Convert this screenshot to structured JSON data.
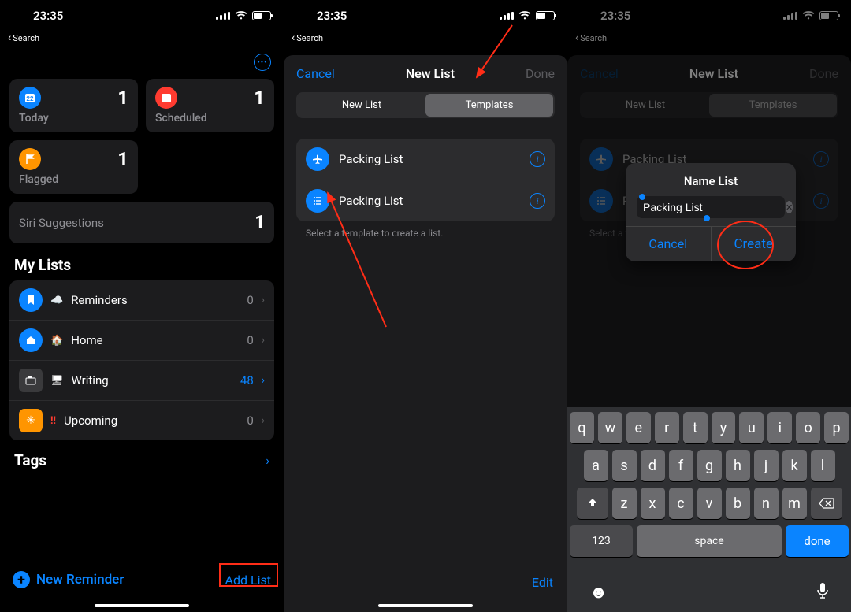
{
  "status": {
    "time": "23:35",
    "back": "Search"
  },
  "colors": {
    "accent": "#0a84ff",
    "today": "#0a84ff",
    "scheduled": "#ff3b30",
    "flagged": "#ff9500",
    "highlight_box": "#ff2d17"
  },
  "s1": {
    "cards": {
      "today": {
        "label": "Today",
        "count": "1"
      },
      "scheduled": {
        "label": "Scheduled",
        "count": "1"
      },
      "flagged": {
        "label": "Flagged",
        "count": "1"
      }
    },
    "siri": {
      "label": "Siri Suggestions",
      "count": "1"
    },
    "mylists_header": "My Lists",
    "lists": [
      {
        "name": "Reminders",
        "count": "0",
        "icon_bg": "#0a84ff"
      },
      {
        "name": "Home",
        "count": "0",
        "icon_bg": "#0a84ff"
      },
      {
        "name": "Writing",
        "count": "48",
        "icon_bg": "#3a3a3c"
      },
      {
        "name": "Upcoming",
        "count": "0",
        "icon_bg": "#ff9500"
      }
    ],
    "tags_label": "Tags",
    "new_reminder": "New Reminder",
    "add_list": "Add List"
  },
  "s2": {
    "cancel": "Cancel",
    "title": "New List",
    "done": "Done",
    "seg_newlist": "New List",
    "seg_templates": "Templates",
    "templates": [
      {
        "name": "Packing List",
        "icon": "plane"
      },
      {
        "name": "Packing List",
        "icon": "list"
      }
    ],
    "helper": "Select a template to create a list.",
    "edit": "Edit"
  },
  "s3": {
    "cancel": "Cancel",
    "title": "New List",
    "done": "Done",
    "seg_newlist": "New List",
    "seg_templates": "Templates",
    "templates": [
      {
        "name": "Packing List",
        "icon": "plane"
      },
      {
        "name": "Packing List",
        "icon": "list"
      }
    ],
    "helper": "Select a template to create a list.",
    "popup": {
      "title": "Name List",
      "value": "Packing List",
      "cancel": "Cancel",
      "create": "Create"
    },
    "keyboard": {
      "row1": [
        "q",
        "w",
        "e",
        "r",
        "t",
        "y",
        "u",
        "i",
        "o",
        "p"
      ],
      "row2": [
        "a",
        "s",
        "d",
        "f",
        "g",
        "h",
        "j",
        "k",
        "l"
      ],
      "row3": [
        "z",
        "x",
        "c",
        "v",
        "b",
        "n",
        "m"
      ],
      "n123": "123",
      "space": "space",
      "done": "done"
    }
  }
}
